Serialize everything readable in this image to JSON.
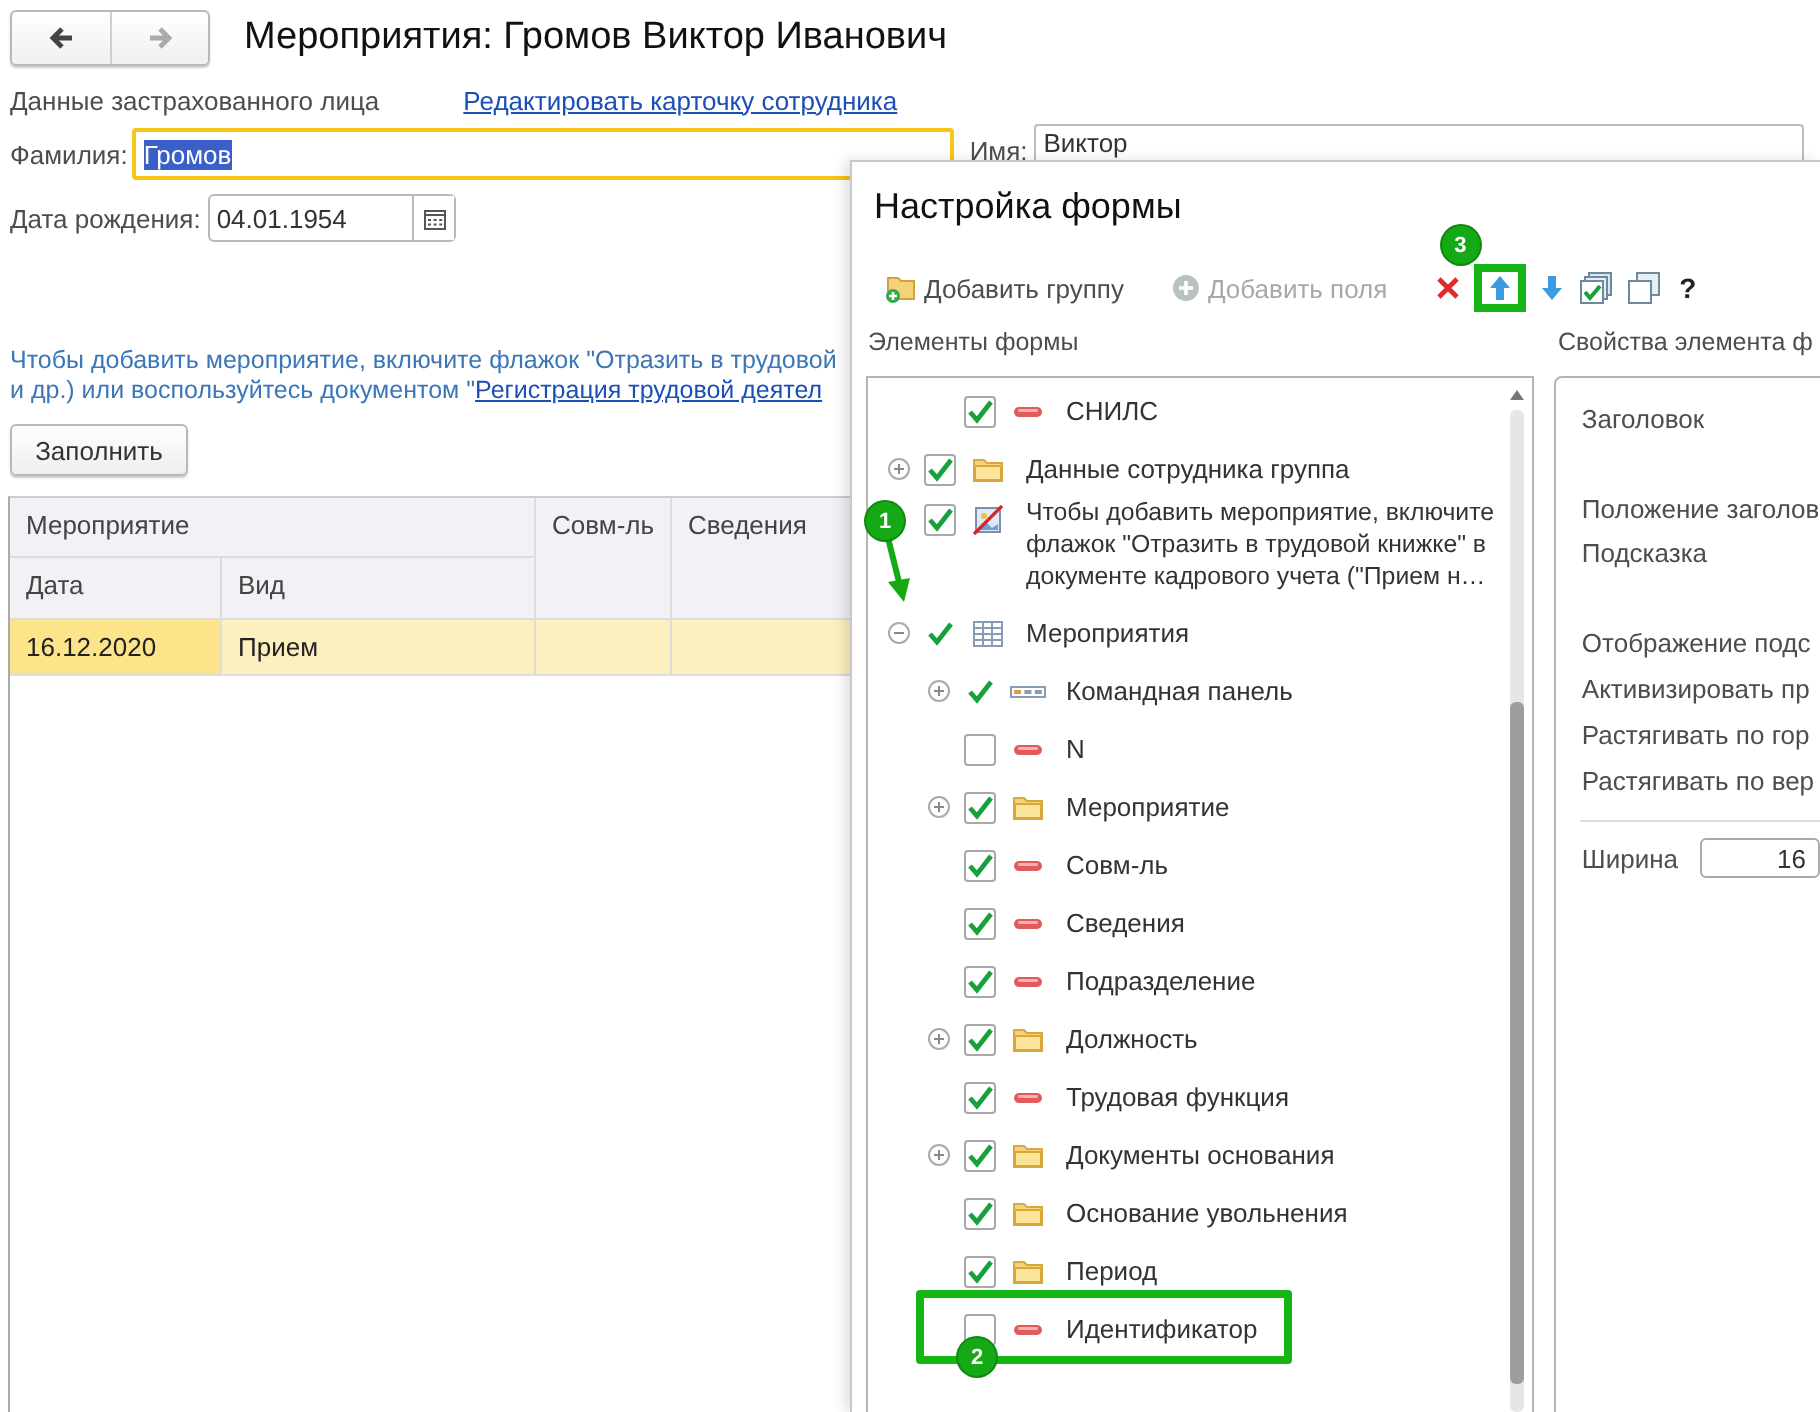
{
  "form": {
    "title": "Мероприятия: Громов Виктор Иванович",
    "nav": {
      "back_enabled": true,
      "forward_enabled": false
    },
    "section_label": "Данные застрахованного лица",
    "edit_link": "Редактировать карточку сотрудника",
    "fields": [
      {
        "label": "Фамилия:",
        "value": "Громов",
        "focused": true,
        "text_selected": true
      },
      {
        "label": "Имя:",
        "value": "Виктор",
        "focused": false,
        "text_selected": false
      }
    ],
    "birth_date": {
      "label": "Дата рождения:",
      "value": "04.01.1954"
    },
    "info": {
      "line1": "Чтобы добавить мероприятие, включите флажок \"Отразить в трудовой",
      "line2": "и др.) или воспользуйтесь документом \"",
      "link": "Регистрация трудовой деятел"
    },
    "fill_button": "Заполнить",
    "table": {
      "group_column": "Мероприятие",
      "columns": [
        "Дата",
        "Вид",
        "Совм-ль",
        "Сведения"
      ],
      "rows": [
        {
          "cells": [
            "16.12.2020",
            "Прием"
          ],
          "selected": true
        }
      ]
    }
  },
  "dialog": {
    "title": "Настройка формы",
    "toolbar": [
      {
        "kind": "add_group",
        "label": "Добавить группу",
        "disabled": false,
        "highlighted": false
      },
      {
        "kind": "add_fields",
        "label": "Добавить поля",
        "disabled": true,
        "highlighted": false
      },
      {
        "kind": "delete",
        "highlighted": false
      },
      {
        "kind": "move_up",
        "highlighted": true,
        "callout": "3"
      },
      {
        "kind": "move_down",
        "highlighted": false
      },
      {
        "kind": "check_all",
        "highlighted": false
      },
      {
        "kind": "copy",
        "highlighted": false
      },
      {
        "kind": "help",
        "label": "?",
        "highlighted": false
      }
    ],
    "elements_label": "Элементы формы",
    "properties_label": "Свойства элемента ф",
    "tree": {
      "scrolled_parent_children": [
        {
          "label": "СНИЛС",
          "kind": "field",
          "checked": true,
          "disabled": false
        }
      ],
      "items": [
        {
          "label": "Данные сотрудника группа",
          "kind": "folder",
          "checked": true,
          "disabled": false,
          "expanded": false
        },
        {
          "label": "Чтобы добавить мероприятие, включите флажок \"Отразить в трудовой книжке\" в документе кадрового учета (\"Прием н…",
          "kind": "decoration",
          "checked": true,
          "disabled": false
        },
        {
          "label": "Мероприятия",
          "kind": "table",
          "checked": true,
          "disabled": true,
          "expanded": true,
          "callout": "1",
          "highlighted": false,
          "children": [
            {
              "label": "Командная панель",
              "kind": "command_bar",
              "checked": true,
              "disabled": true,
              "expanded": false
            },
            {
              "label": "N",
              "kind": "field",
              "checked": false,
              "disabled": false
            },
            {
              "label": "Мероприятие",
              "kind": "folder",
              "checked": true,
              "disabled": false,
              "expanded": false
            },
            {
              "label": "Совм-ль",
              "kind": "field",
              "checked": true,
              "disabled": false
            },
            {
              "label": "Сведения",
              "kind": "field",
              "checked": true,
              "disabled": false
            },
            {
              "label": "Подразделение",
              "kind": "field",
              "checked": true,
              "disabled": false
            },
            {
              "label": "Должность",
              "kind": "folder",
              "checked": true,
              "disabled": false,
              "expanded": false
            },
            {
              "label": "Трудовая функция",
              "kind": "field",
              "checked": true,
              "disabled": false
            },
            {
              "label": "Документы основания",
              "kind": "folder",
              "checked": true,
              "disabled": false,
              "expanded": false
            },
            {
              "label": "Основание увольнения",
              "kind": "folder",
              "checked": true,
              "disabled": false
            },
            {
              "label": "Период",
              "kind": "folder",
              "checked": true,
              "disabled": false
            },
            {
              "label": "Идентификатор",
              "kind": "field",
              "checked": false,
              "disabled": false,
              "callout": "2",
              "highlighted": true
            }
          ]
        }
      ]
    },
    "properties": {
      "items": [
        {
          "label": "Заголовок",
          "kind": "multiline"
        },
        {
          "label": "Положение заголов",
          "kind": "single"
        },
        {
          "label": "Подсказка",
          "kind": "multiline"
        },
        {
          "label": "Отображение подс",
          "kind": "single"
        },
        {
          "label": "Активизировать пр",
          "kind": "single"
        },
        {
          "label": "Растягивать по гор",
          "kind": "single"
        },
        {
          "label": "Растягивать по вер",
          "kind": "single"
        }
      ],
      "width": {
        "label": "Ширина",
        "value": "16"
      }
    }
  }
}
